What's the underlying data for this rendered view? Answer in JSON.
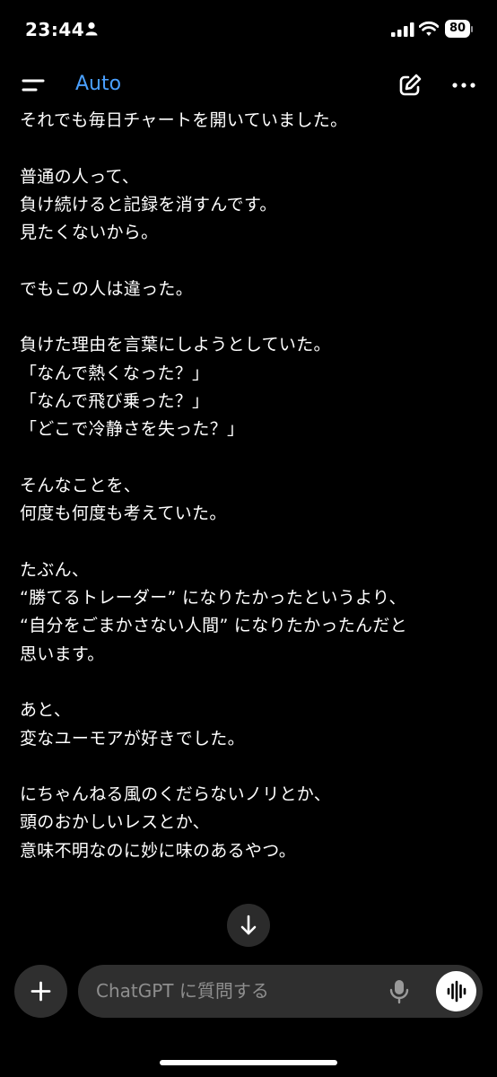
{
  "status_bar": {
    "time": "23:44",
    "battery": "80",
    "icons": [
      "person-icon",
      "signal-icon",
      "wifi-icon",
      "battery-icon"
    ]
  },
  "header": {
    "model": "Auto",
    "icons": [
      "menu-icon",
      "new-chat-icon",
      "more-icon"
    ],
    "accent_color": "#4aa0ff"
  },
  "message": {
    "text": "それでも毎日チャートを開いていました。\n\n普通の人って、\n負け続けると記録を消すんです。\n見たくないから。\n\nでもこの人は違った。\n\n負けた理由を言葉にしようとしていた。\n「なんで熱くなった？」\n「なんで飛び乗った？」\n「どこで冷静さを失った？」\n\nそんなことを、\n何度も何度も考えていた。\n\nたぶん、\n“勝てるトレーダー” になりたかったというより、\n“自分をごまかさない人間” になりたかったんだと\n思います。\n\nあと、\n変なユーモアが好きでした。\n\nにちゃんねる風のくだらないノリとか、\n頭のおかしいレスとか、\n意味不明なのに妙に味のあるやつ。"
  },
  "composer": {
    "placeholder": "ChatGPT に質問する",
    "icons": [
      "plus-icon",
      "mic-icon",
      "voice-mode-icon",
      "arrow-down-icon"
    ]
  }
}
